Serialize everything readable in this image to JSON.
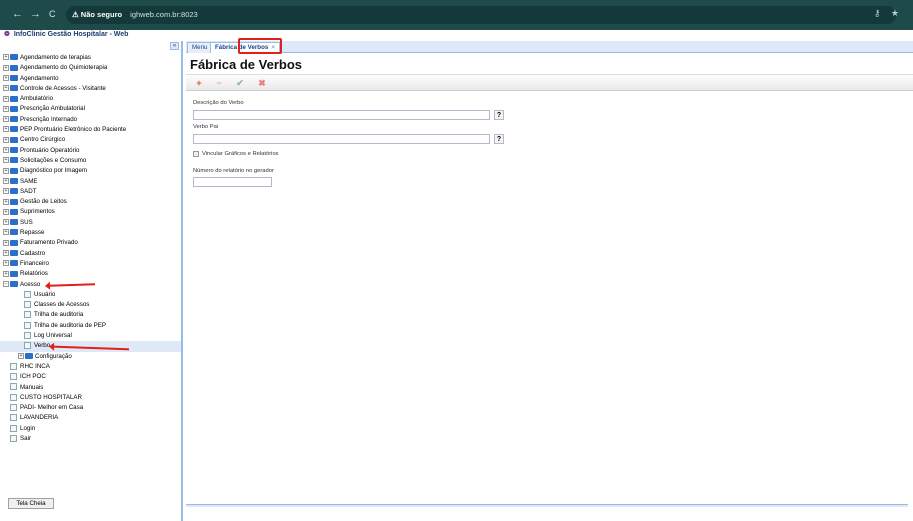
{
  "browser": {
    "back_icon": "←",
    "forward_icon": "→",
    "reload_icon": "C",
    "security_label": "⚠ Não seguro",
    "url": "ighweb.com.br:8023",
    "key_icon": "⚷",
    "star_icon": "★"
  },
  "app": {
    "title": "InfoClinic Gestão Hospitalar - Web",
    "logo": "❁"
  },
  "sidebar": {
    "collapse_label": "«",
    "tree": [
      {
        "label": "Agendamento de terapias",
        "type": "folder",
        "toggle": "+"
      },
      {
        "label": "Agendamento do Quimioterapia",
        "type": "folder",
        "toggle": "+"
      },
      {
        "label": "Agendamento",
        "type": "folder",
        "toggle": "+"
      },
      {
        "label": "Controle de Acessos - Visitante",
        "type": "folder",
        "toggle": "+"
      },
      {
        "label": "Ambulatório",
        "type": "folder",
        "toggle": "+"
      },
      {
        "label": "Prescrição Ambulatorial",
        "type": "folder",
        "toggle": "+"
      },
      {
        "label": "Prescrição Internado",
        "type": "folder",
        "toggle": "+"
      },
      {
        "label": "PEP Prontuário Eletrônico do Paciente",
        "type": "folder",
        "toggle": "+"
      },
      {
        "label": "Centro Cirúrgico",
        "type": "folder",
        "toggle": "+"
      },
      {
        "label": "Prontuário Operatório",
        "type": "folder",
        "toggle": "+"
      },
      {
        "label": "Solicitações e Consumo",
        "type": "folder",
        "toggle": "+"
      },
      {
        "label": "Diagnóstico por Imagem",
        "type": "folder",
        "toggle": "+"
      },
      {
        "label": "SAME",
        "type": "folder",
        "toggle": "+"
      },
      {
        "label": "SADT",
        "type": "folder",
        "toggle": "+"
      },
      {
        "label": "Gestão de Leitos",
        "type": "folder",
        "toggle": "+"
      },
      {
        "label": "Suprimentos",
        "type": "folder",
        "toggle": "+"
      },
      {
        "label": "SUS",
        "type": "folder",
        "toggle": "+"
      },
      {
        "label": "Repasse",
        "type": "folder",
        "toggle": "+"
      },
      {
        "label": "Faturamento Privado",
        "type": "folder",
        "toggle": "+"
      },
      {
        "label": "Cadastro",
        "type": "folder",
        "toggle": "+"
      },
      {
        "label": "Financeiro",
        "type": "folder",
        "toggle": "+"
      },
      {
        "label": "Relatórios",
        "type": "folder",
        "toggle": "+"
      },
      {
        "label": "Acesso",
        "type": "folder",
        "toggle": "−"
      },
      {
        "label": "Usuário",
        "type": "page",
        "level": 1
      },
      {
        "label": "Classes de Acessos",
        "type": "page",
        "level": 1
      },
      {
        "label": "Trilha de auditoria",
        "type": "page",
        "level": 1
      },
      {
        "label": "Trilha de auditoria de PEP",
        "type": "page",
        "level": 1
      },
      {
        "label": "Log Universal",
        "type": "page",
        "level": 1
      },
      {
        "label": "Verbo",
        "type": "page",
        "level": 1,
        "selected": true
      },
      {
        "label": "Configuração",
        "type": "folder",
        "toggle": "+",
        "level": 1
      },
      {
        "label": "RHC INCA",
        "type": "page"
      },
      {
        "label": "ICH POC",
        "type": "page"
      },
      {
        "label": "Manuais",
        "type": "page"
      },
      {
        "label": "CUSTO HOSPITALAR",
        "type": "page"
      },
      {
        "label": "PADI- Melhor em Casa",
        "type": "page"
      },
      {
        "label": "LAVANDERIA",
        "type": "page"
      },
      {
        "label": "Login",
        "type": "page"
      },
      {
        "label": "Sair",
        "type": "page"
      }
    ],
    "fullscreen_label": "Tela Cheia"
  },
  "tabs": [
    {
      "label": "Menu"
    },
    {
      "label": "Fábrica de Verbos",
      "close": "×"
    }
  ],
  "page": {
    "title": "Fábrica de Verbos",
    "toolbar": {
      "add": "+",
      "remove": "−",
      "confirm": "✔",
      "cancel": "✖"
    },
    "fields": {
      "verb_description_label": "Descrição do Verbo",
      "verb_description_value": "",
      "parent_verb_label": "Verbo Pai",
      "parent_verb_value": "",
      "help_label": "?",
      "link_reports_label": "Vincular Gráficos e Relatórios",
      "generator_report_label": "Número do relatório no gerador",
      "generator_report_value": ""
    }
  }
}
